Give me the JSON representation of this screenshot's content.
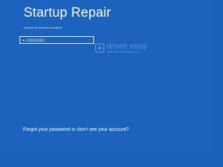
{
  "window": {
    "title": "Startup Repair",
    "subtitle": "Choose an account to continue."
  },
  "account": {
    "name": ""
  },
  "watermark": {
    "brand": "driver easy",
    "url": "www.DriverEasy.com"
  },
  "footer": {
    "forgot_link": "Forgot your password or don't see your account?"
  },
  "colors": {
    "background": "#1b63be",
    "text": "#ffffff"
  }
}
